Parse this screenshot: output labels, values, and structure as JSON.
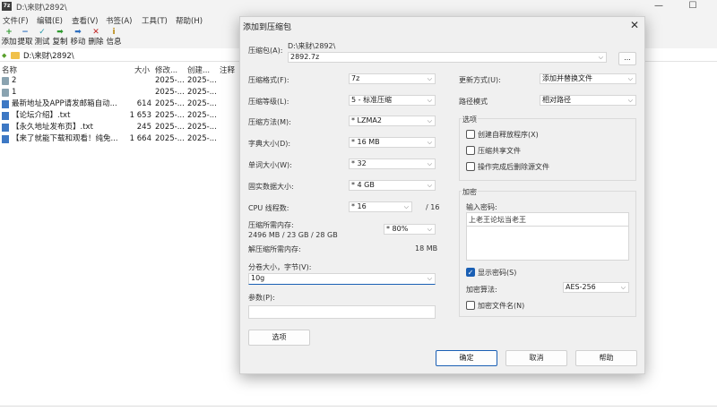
{
  "window": {
    "icon_text": "7z",
    "title": "D:\\来财\\2892\\",
    "controls": {
      "minimize": "—",
      "maximize": "☐"
    }
  },
  "menubar": [
    "文件(F)",
    "编辑(E)",
    "查看(V)",
    "书签(A)",
    "工具(T)",
    "帮助(H)"
  ],
  "toolbar": [
    {
      "label": "添加",
      "icon": "+",
      "color": "#2e9a2e",
      "name": "add"
    },
    {
      "label": "提取",
      "icon": "−",
      "color": "#2e6fbf",
      "name": "extract"
    },
    {
      "label": "测试",
      "icon": "✓",
      "color": "#2a9aa8",
      "name": "test"
    },
    {
      "label": "复制",
      "icon": "➡",
      "color": "#2e9a2e",
      "name": "copy"
    },
    {
      "label": "移动",
      "icon": "➡",
      "color": "#2e6fbf",
      "name": "move"
    },
    {
      "label": "删除",
      "icon": "✕",
      "color": "#c02020",
      "name": "delete"
    },
    {
      "label": "信息",
      "icon": "i",
      "color": "#b8860b",
      "name": "info"
    }
  ],
  "address": {
    "path": "D:\\来财\\2892\\"
  },
  "filelist": {
    "headers": {
      "name": "名称",
      "size": "大小",
      "modified": "修改...",
      "created": "创建...",
      "comment": "注释"
    },
    "rows": [
      {
        "type": "folder",
        "name": "2",
        "size": "",
        "modified": "2025-...",
        "created": "2025-..."
      },
      {
        "type": "folder",
        "name": "1",
        "size": "",
        "modified": "2025-...",
        "created": "2025-..."
      },
      {
        "type": "file",
        "name": "最新地址及APP请发邮箱自动...",
        "size": "614",
        "modified": "2025-...",
        "created": "2025-..."
      },
      {
        "type": "file",
        "name": "【论坛介绍】.txt",
        "size": "1 653",
        "modified": "2025-...",
        "created": "2025-..."
      },
      {
        "type": "file",
        "name": "【永久地址发布页】.txt",
        "size": "245",
        "modified": "2025-...",
        "created": "2025-..."
      },
      {
        "type": "file",
        "name": "【来了就能下载和观看！纯免...",
        "size": "1 664",
        "modified": "2025-...",
        "created": "2025-..."
      }
    ]
  },
  "dialog": {
    "title": "添加到压缩包",
    "close": "✕",
    "archive_label": "压缩包(A):",
    "archive_dir": "D:\\来财\\2892\\",
    "archive_name": "2892.7z",
    "browse": "...",
    "format_label": "压缩格式(F):",
    "format_value": "7z",
    "level_label": "压缩等级(L):",
    "level_value": "5 - 标准压缩",
    "method_label": "压缩方法(M):",
    "method_value": "* LZMA2",
    "dict_label": "字典大小(D):",
    "dict_value": "* 16 MB",
    "word_label": "单词大小(W):",
    "word_value": "* 32",
    "solid_label": "固实数据大小:",
    "solid_value": "* 4 GB",
    "cpu_label": "CPU 线程数:",
    "cpu_value": "* 16",
    "cpu_total": "/ 16",
    "mem_label": "压缩所需内存:",
    "mem_value": "2496 MB / 23 GB / 28 GB",
    "mem_pct": "* 80%",
    "decomp_label": "解压缩所需内存:",
    "decomp_value": "18 MB",
    "split_label": "分卷大小，字节(V):",
    "split_value": "10g",
    "params_label": "参数(P):",
    "params_value": "",
    "options_button": "选项",
    "update_label": "更新方式(U):",
    "update_value": "添加并替换文件",
    "path_label": "路径模式",
    "path_value": "相对路径",
    "options_group": "选项",
    "opt_sfx": "创建自释放程序(X)",
    "opt_shared": "压缩共享文件",
    "opt_delete": "操作完成后删除源文件",
    "encrypt_group": "加密",
    "pwd_label": "输入密码:",
    "pwd_value": "上老王论坛当老王",
    "show_pwd": "显示密码(S)",
    "enc_method_label": "加密算法:",
    "enc_method_value": "AES-256",
    "enc_names": "加密文件名(N)",
    "ok": "确定",
    "cancel": "取消",
    "help": "帮助"
  },
  "checkmark": "✓",
  "arrow": "⌵"
}
